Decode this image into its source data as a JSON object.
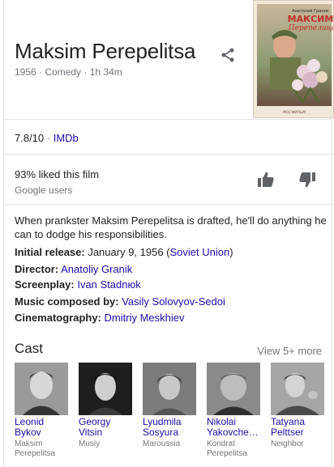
{
  "header": {
    "title": "Maksim Perepelitsa",
    "subtitle": "1956 · Comedy · 1h 34m"
  },
  "poster": {
    "top_line": "Анатолий Граник",
    "title_line1": "МАКСИМ",
    "title_line2": "Перепелица",
    "bottom_line": "МОСФИЛЬМ"
  },
  "rating": {
    "score": "7.8/10",
    "separator": " · ",
    "source": "IMDb"
  },
  "audience": {
    "liked": "93% liked this film",
    "source": "Google users"
  },
  "description": "When prankster Maksim Perepelitsa is drafted, he'll do anything he can to dodge his responsibilities.",
  "facts": [
    {
      "label": "Initial release:",
      "value": " January 9, 1956 (",
      "link": "Soviet Union",
      "suffix": ")"
    },
    {
      "label": "Director:",
      "value": " ",
      "link": "Anatoliy Granik",
      "suffix": ""
    },
    {
      "label": "Screenplay:",
      "value": " ",
      "link": "Ivan Stadnюk",
      "suffix": ""
    },
    {
      "label": "Music composed by:",
      "value": " ",
      "link": "Vasily Solovyov-Sedoi",
      "suffix": ""
    },
    {
      "label": "Cinematography:",
      "value": " ",
      "link": "Dmitriy Meskhiev",
      "suffix": ""
    }
  ],
  "cast": {
    "heading": "Cast",
    "view_more": "View 5+ more",
    "members": [
      {
        "first": "Leonid",
        "last": "Bykov",
        "role": "Maksim Perepelitsa"
      },
      {
        "first": "Georgy",
        "last": "Vitsin",
        "role": "Musiy"
      },
      {
        "first": "Lyudmila",
        "last": "Sosyura",
        "role": "Maroussia"
      },
      {
        "first": "Nikolai",
        "last": "Yakovche…",
        "role": "Kondrat Perepelitsa"
      },
      {
        "first": "Tatyana",
        "last": "Pelttser",
        "role": "Neighbor"
      }
    ]
  },
  "colors": {
    "link": "#1a0dab",
    "muted": "#70757a",
    "text": "#222222",
    "icon": "#5f6368"
  }
}
